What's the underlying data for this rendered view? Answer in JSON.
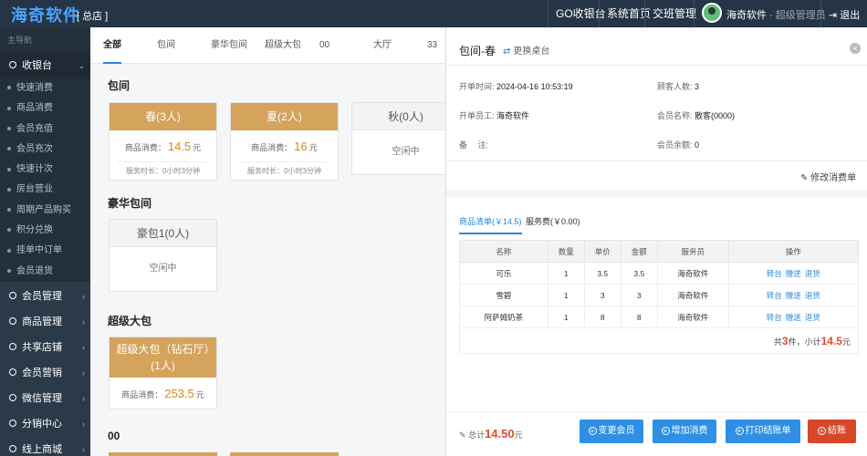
{
  "header": {
    "logo": "海奇软件",
    "store": "[ 总店 ]",
    "nav": [
      "GO收银台",
      "系统首页",
      "交班管理"
    ],
    "user_name": "海奇软件",
    "user_role": "- 超级管理员",
    "logout": "退出"
  },
  "sidebar": {
    "heading": "主导航",
    "open_group": "收银台",
    "sub_items": [
      "快速消费",
      "商品消费",
      "会员充值",
      "会员充次",
      "快速计次",
      "房台营业",
      "周期产品购买",
      "积分兑换",
      "挂单中订单",
      "会员退货"
    ],
    "groups": [
      "会员管理",
      "商品管理",
      "共享店铺",
      "会员营销",
      "微信管理",
      "分销中心",
      "线上商城"
    ]
  },
  "main": {
    "tabs": [
      "全部",
      "包间",
      "豪华包间",
      "超级大包",
      "00",
      "大厅",
      "33"
    ],
    "sections": {
      "s1": "包间",
      "s2": "豪华包间",
      "s3": "超级大包",
      "s4": "00"
    },
    "spend_label": "商品消费：",
    "yuan": "元",
    "rooms": {
      "chun": {
        "name": "春(3人)",
        "amount": "14.5",
        "duration": "服务时长：0小时3分钟"
      },
      "xia": {
        "name": "夏(2人)",
        "amount": "16",
        "duration": "服务时长：0小时3分钟"
      },
      "qiu": {
        "name": "秋(0人)",
        "status": "空闲中"
      },
      "haobao": {
        "name": "豪包1(0人)",
        "status": "空闲中"
      },
      "super": {
        "name": "超级大包（钻石厅）(1人)",
        "amount": "253.5"
      }
    }
  },
  "panel": {
    "title": "包间-春",
    "swap": "更换桌台",
    "close": "×",
    "open_time_label": "开单时间:",
    "open_time": "2024-04-16 10:53:19",
    "guests_label": "顾客人数:",
    "guests": "3",
    "staff_label": "开单员工:",
    "staff": "海奇软件",
    "member_label": "会员名称:",
    "member": "散客(0000)",
    "remark_label": "备　 注:",
    "balance_label": "会员余额:",
    "balance": "0",
    "edit_order": "修改消费单",
    "subtab_goods": "商品清单(￥14.5)",
    "subtab_service": "服务费(￥0.00)",
    "columns": [
      "名称",
      "数量",
      "单价",
      "金额",
      "服务员",
      "操作"
    ],
    "rows": [
      {
        "name": "可乐",
        "qty": "1",
        "price": "3.5",
        "amount": "3.5",
        "waiter": "海奇软件"
      },
      {
        "name": "雪碧",
        "qty": "1",
        "price": "3",
        "amount": "3",
        "waiter": "海奇软件"
      },
      {
        "name": "阿萨姆奶茶",
        "qty": "1",
        "price": "8",
        "amount": "8",
        "waiter": "海奇软件"
      }
    ],
    "ops": [
      "转台",
      "赠送",
      "退货"
    ],
    "summary_pre": "共",
    "summary_count": "3",
    "summary_mid": "件，小计",
    "summary_total": "14.5",
    "summary_post": "元",
    "total_label": "总计",
    "total": "14.50",
    "total_unit": "元",
    "buttons": [
      "变更会员",
      "增加消费",
      "打印结账单",
      "结账"
    ]
  },
  "colors": {
    "topbar": "#263545",
    "sidebar": "#2b3a48",
    "busy_room": "#d4a35c",
    "accent_blue": "#2f8fe4",
    "checkout_red": "#d9472b"
  }
}
